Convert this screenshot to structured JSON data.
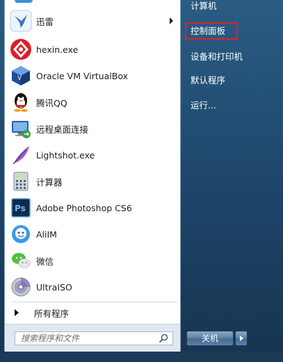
{
  "programs": [
    {
      "label": "迅雷",
      "icon": "thunder-icon",
      "has_submenu": true
    },
    {
      "label": "hexin.exe",
      "icon": "hexin-icon"
    },
    {
      "label": "Oracle VM VirtualBox",
      "icon": "virtualbox-icon"
    },
    {
      "label": "腾讯QQ",
      "icon": "qq-penguin-icon"
    },
    {
      "label": "远程桌面连接",
      "icon": "remote-desktop-icon"
    },
    {
      "label": "Lightshot.exe",
      "icon": "feather-icon"
    },
    {
      "label": "计算器",
      "icon": "calculator-icon"
    },
    {
      "label": "Adobe Photoshop CS6",
      "icon": "photoshop-icon"
    },
    {
      "label": "AliIM",
      "icon": "aliim-icon"
    },
    {
      "label": "微信",
      "icon": "wechat-icon"
    },
    {
      "label": "UltraISO",
      "icon": "disc-icon"
    }
  ],
  "all_programs": "所有程序",
  "search": {
    "placeholder": "搜索程序和文件"
  },
  "right_panel": {
    "items": [
      "计算机",
      "控制面板",
      "设备和打印机",
      "默认程序",
      "运行..."
    ],
    "highlighted": "控制面板"
  },
  "shutdown": {
    "label": "关机"
  },
  "colors": {
    "highlight_border": "#e2202a",
    "panel_blue": "#1c4266"
  }
}
